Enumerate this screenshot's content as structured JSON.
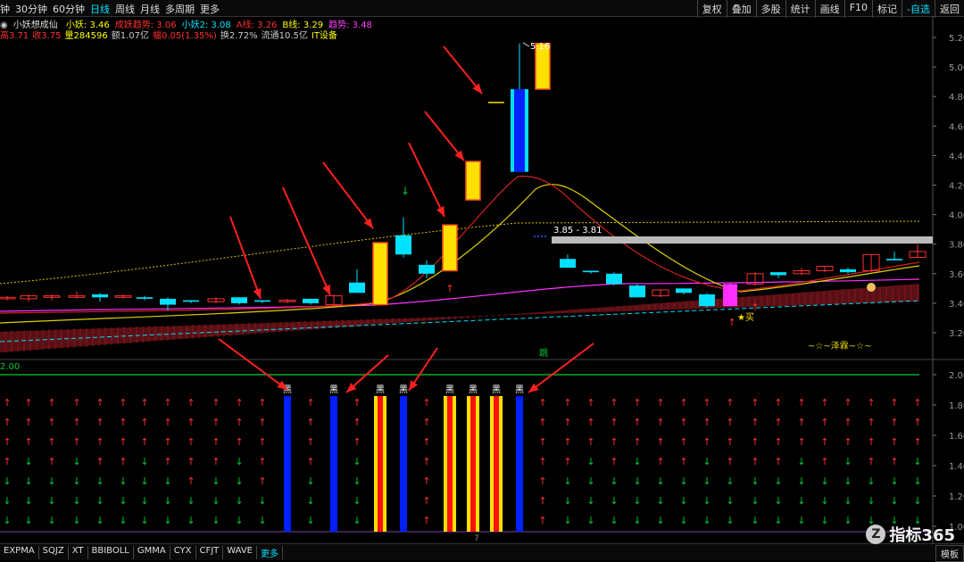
{
  "toolbar": {
    "periods": [
      "钟",
      "30分钟",
      "60分钟",
      "日线",
      "周线",
      "月线",
      "多周期",
      "更多"
    ],
    "active_period": "日线",
    "right_buttons": [
      "复权",
      "叠加",
      "多股",
      "统计",
      "画线",
      "F10",
      "标记",
      "-自选",
      "返回"
    ]
  },
  "indicators": {
    "name": "小妖想成仙",
    "items": [
      {
        "label": "小妖: 3.46",
        "color": "#ffff00"
      },
      {
        "label": "成妖趋势: 3.06",
        "color": "#ff3030"
      },
      {
        "label": "小妖2: 3.08",
        "color": "#00e0ff"
      },
      {
        "label": "A线: 3.26",
        "color": "#ff3030"
      },
      {
        "label": "B线: 3.29",
        "color": "#ffff00"
      },
      {
        "label": "趋势: 3.48",
        "color": "#ff40ff"
      }
    ]
  },
  "quote": {
    "items": [
      {
        "label": "高3.71",
        "color": "#ff3030"
      },
      {
        "label": "收3.75",
        "color": "#ff3030"
      },
      {
        "label": "量284596",
        "color": "#ffff00"
      },
      {
        "label": "额1.07亿",
        "color": "#cccccc"
      },
      {
        "label": "幅0.05(1.35%)",
        "color": "#ff3030"
      },
      {
        "label": "换2.72%",
        "color": "#cccccc"
      },
      {
        "label": "流通10.5亿",
        "color": "#cccccc"
      },
      {
        "label": "IT设备",
        "color": "#ffff00"
      }
    ]
  },
  "price_axis": [
    "5.20",
    "5.00",
    "4.80",
    "4.60",
    "4.40",
    "4.20",
    "4.00",
    "3.80",
    "3.60",
    "3.40",
    "3.20"
  ],
  "lower_axis": [
    "2.00",
    "1.80",
    "1.60",
    "1.40",
    "1.20",
    "1.00"
  ],
  "annotations": {
    "high": "5.16",
    "range": "3.85 - 3.81",
    "buy": "★买",
    "jump": "跳",
    "brand": "~☆~泽霖~☆~",
    "lower_value": "2.00",
    "black_label": "黑",
    "cursor_label": "7"
  },
  "colors": {
    "up": "#ff3030",
    "cyan": "#00e0ff",
    "yellow": "#ffe000",
    "blue": "#0020ff",
    "magenta": "#ff30ff",
    "green": "#00cc33",
    "gray": "#bbbbbb"
  },
  "bottom_tabs": [
    "EXPMA",
    "SQJZ",
    "XT",
    "BBIBOLL",
    "GMMA",
    "CYX",
    "CFJT",
    "WAVE",
    "更多"
  ],
  "bottom_right": [
    "模板",
    "指标365"
  ],
  "logo_text": "指标365"
}
